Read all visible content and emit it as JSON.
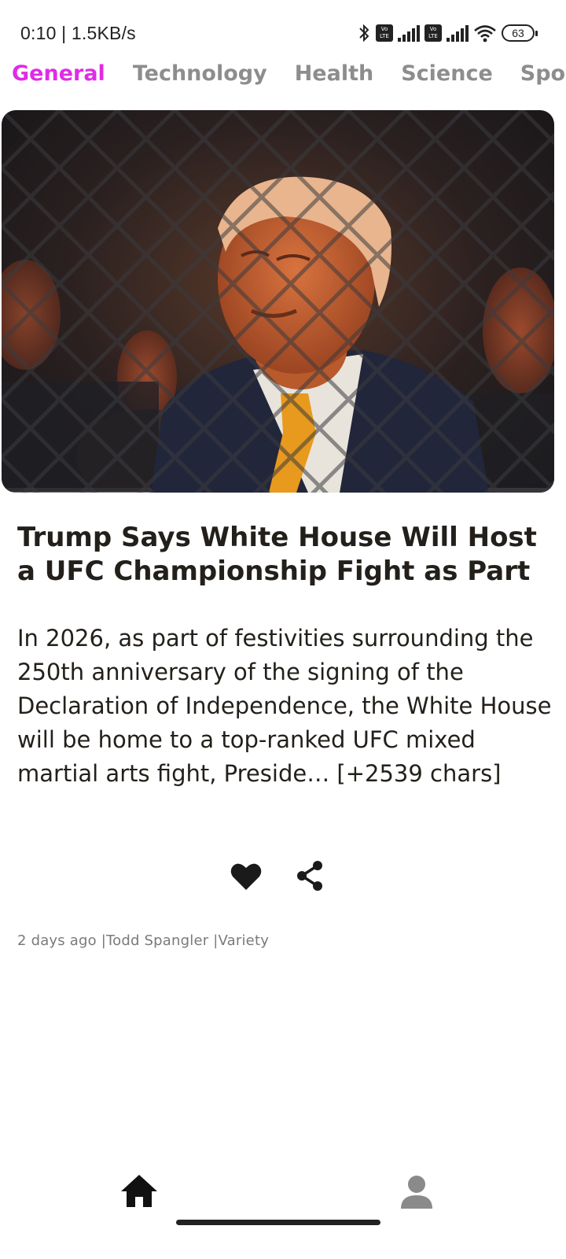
{
  "status_bar": {
    "time_speed": "0:10 | 1.5KB/s",
    "volte_label": "Vo LTE",
    "battery": "63"
  },
  "tabs": [
    {
      "label": "General",
      "active": true
    },
    {
      "label": "Technology",
      "active": false
    },
    {
      "label": "Health",
      "active": false
    },
    {
      "label": "Science",
      "active": false
    },
    {
      "label": "Sports",
      "active": false
    }
  ],
  "article": {
    "image_icon": "news-photo",
    "headline": "Trump Says White House Will Host a UFC Championship Fight as Part",
    "description": "In 2026, as part of festivities surrounding the 250th anniversary of the signing of the Declaration of Independence, the White House will be home to a top-ranked UFC mixed martial arts fight, Preside… [+2539 chars]",
    "meta": "2 days ago |Todd Spangler |Variety"
  },
  "actions": {
    "like_icon": "heart-icon",
    "share_icon": "share-icon"
  },
  "bottom_nav": {
    "home_icon": "home-icon",
    "profile_icon": "person-icon"
  },
  "colors": {
    "accent": "#e02be6",
    "tab_inactive": "#8d8d8d",
    "text": "#231f1a",
    "meta": "#7a7a7a"
  }
}
